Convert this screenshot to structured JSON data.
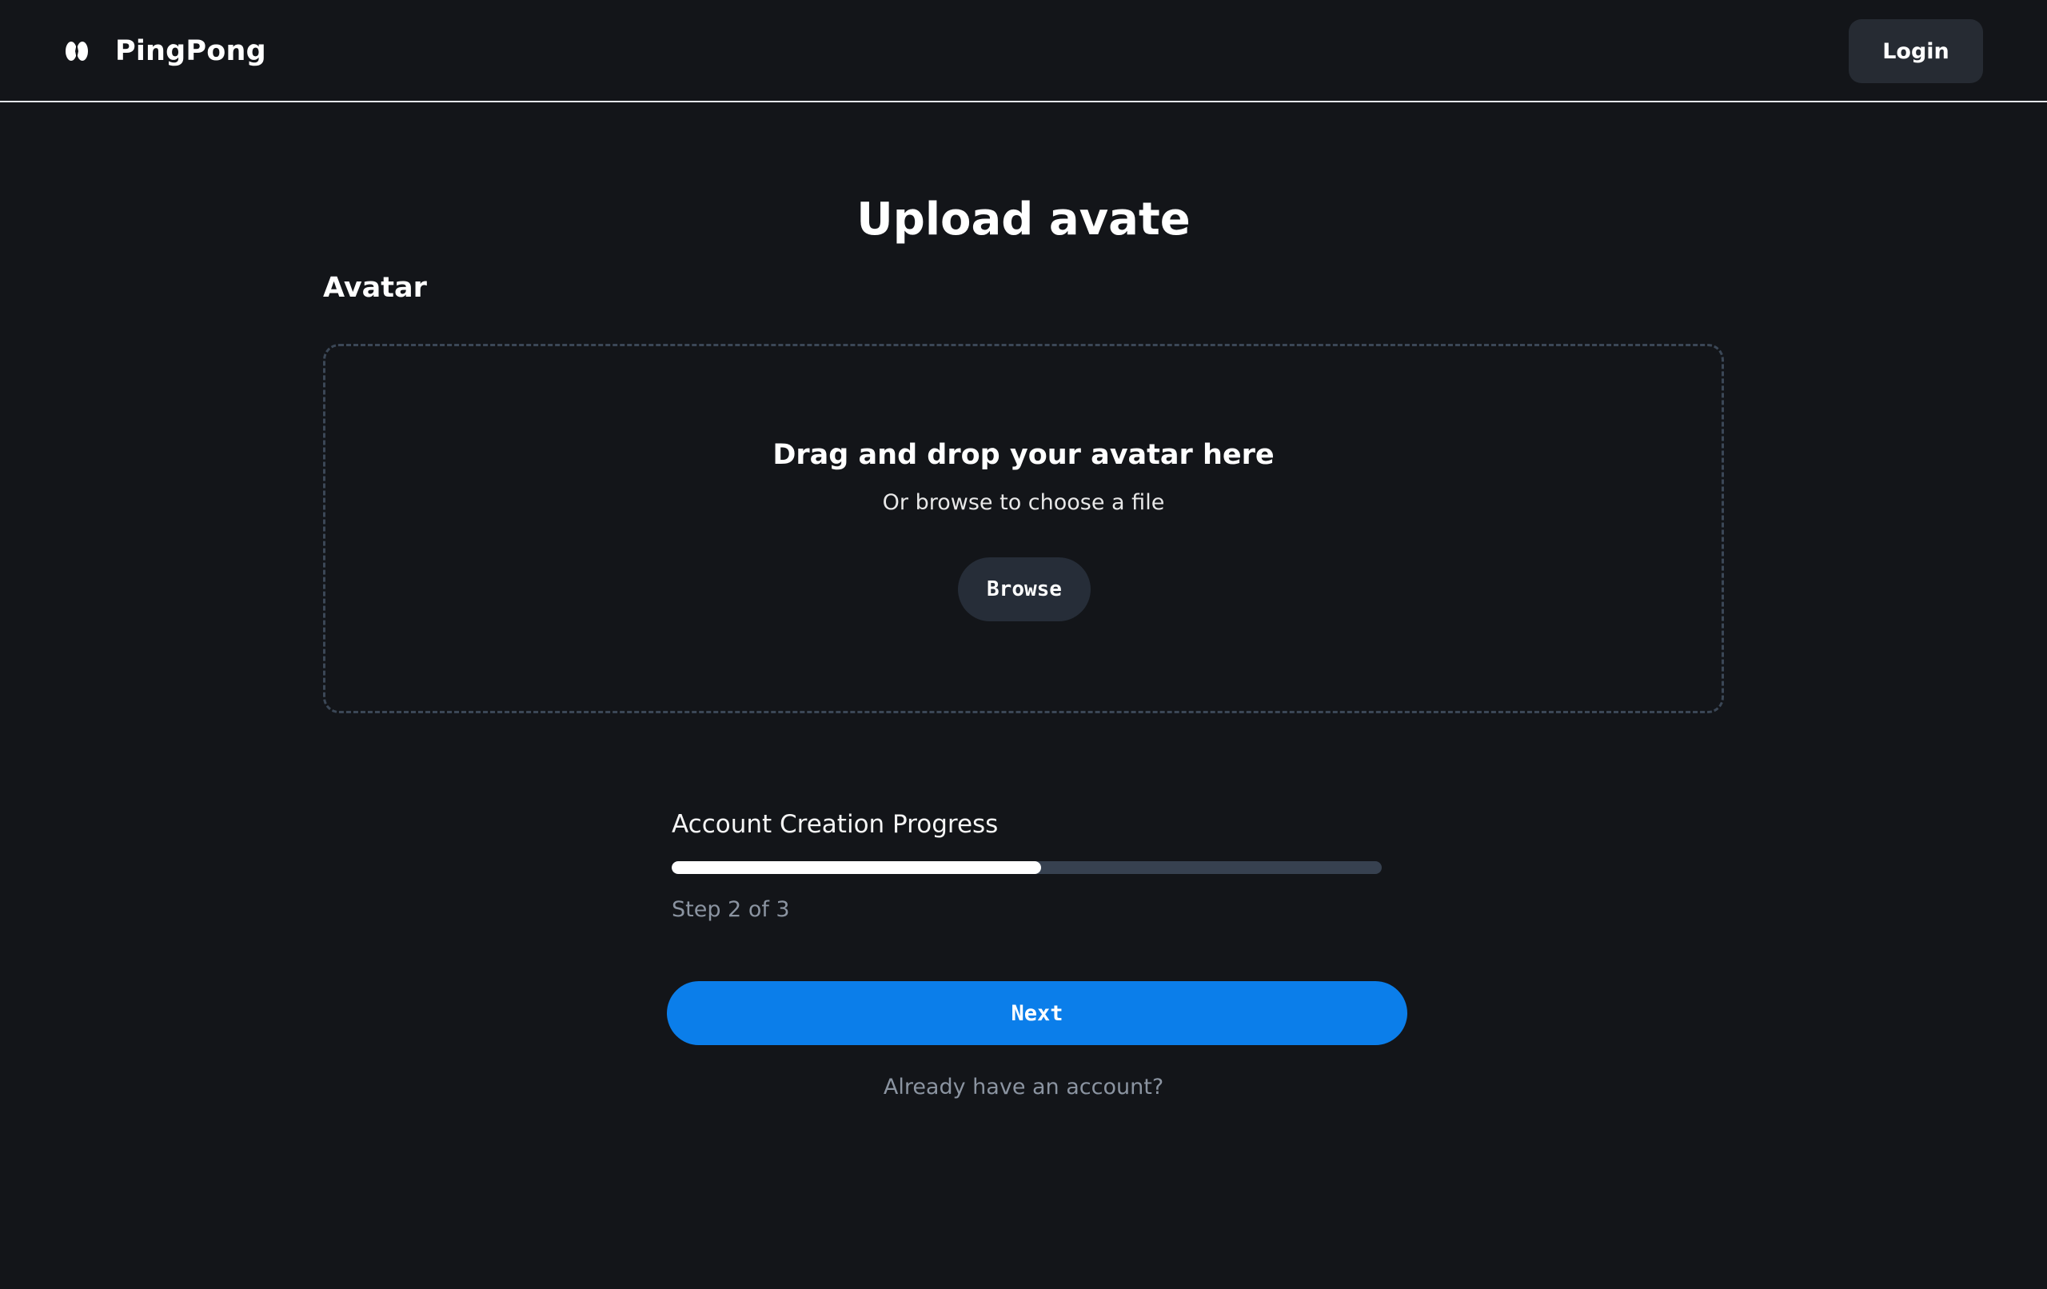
{
  "header": {
    "brand_name": "PingPong",
    "logo_icon": "pingpong-logo-icon",
    "login_label": "Login"
  },
  "main": {
    "title": "Upload avate",
    "section_label": "Avatar"
  },
  "dropzone": {
    "title": "Drag and drop your avatar here",
    "subtitle": "Or browse to choose a file",
    "browse_label": "Browse"
  },
  "progress": {
    "label": "Account Creation Progress",
    "step_text": "Step 2 of 3",
    "fill_fraction": 0.52
  },
  "actions": {
    "next_label": "Next",
    "already_account_text": "Already have an account?"
  },
  "colors": {
    "background": "#131519",
    "accent": "#0b7eea",
    "muted_text": "#8b94a1",
    "secondary_button": "#262b33"
  }
}
